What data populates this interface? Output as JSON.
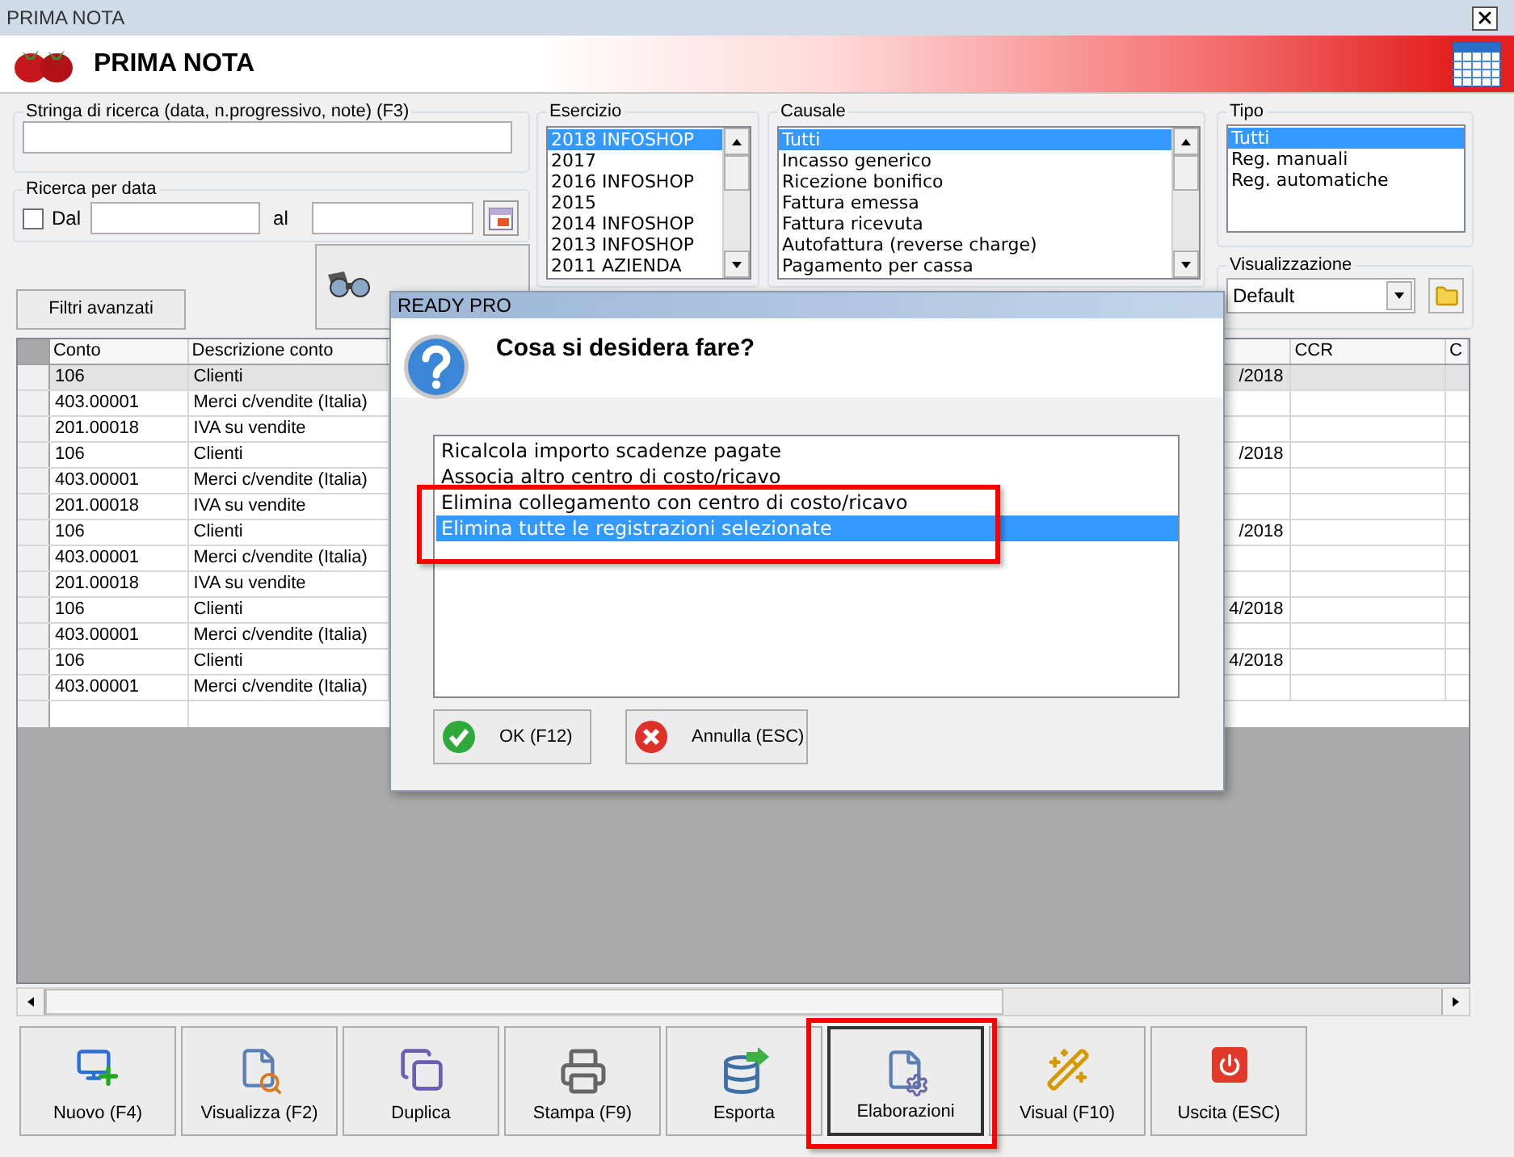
{
  "window": {
    "title": "PRIMA NOTA"
  },
  "header": {
    "title": "PRIMA NOTA"
  },
  "search": {
    "label": "Stringa di ricerca (data, n.progressivo, note) (F3)"
  },
  "date_filter": {
    "label": "Ricerca per data",
    "from_label": "Dal",
    "from_checked": false,
    "to_label": "al"
  },
  "advanced_filters_button": "Filtri avanzati",
  "esercizio": {
    "label": "Esercizio",
    "items": [
      {
        "label": "2018 INFOSHOP",
        "selected": true
      },
      {
        "label": "2017",
        "selected": false
      },
      {
        "label": "2016 INFOSHOP",
        "selected": false
      },
      {
        "label": "2015",
        "selected": false
      },
      {
        "label": "2014 INFOSHOP",
        "selected": false
      },
      {
        "label": "2013 INFOSHOP",
        "selected": false
      },
      {
        "label": "2011 AZIENDA",
        "selected": false
      }
    ]
  },
  "causale": {
    "label": "Causale",
    "items": [
      {
        "label": "Tutti",
        "selected": true
      },
      {
        "label": "Incasso generico",
        "selected": false
      },
      {
        "label": "Ricezione bonifico",
        "selected": false
      },
      {
        "label": "Fattura emessa",
        "selected": false
      },
      {
        "label": "Fattura ricevuta",
        "selected": false
      },
      {
        "label": "Autofattura (reverse charge)",
        "selected": false
      },
      {
        "label": "Pagamento per cassa",
        "selected": false
      }
    ]
  },
  "tipo": {
    "label": "Tipo",
    "items": [
      {
        "label": "Tutti",
        "selected": true
      },
      {
        "label": "Reg. manuali",
        "selected": false
      },
      {
        "label": "Reg. automatiche",
        "selected": false
      }
    ]
  },
  "visualizzazione": {
    "label": "Visualizzazione",
    "value": "Default"
  },
  "table": {
    "columns": [
      "Conto",
      "Descrizione conto",
      "CCR",
      "C"
    ],
    "rows": [
      {
        "conto": "106",
        "descrizione": "Clienti",
        "column_4": "/2018",
        "selected": true
      },
      {
        "conto": "403.00001",
        "descrizione": "Merci c/vendite (Italia)",
        "selected": false
      },
      {
        "conto": "201.00018",
        "descrizione": "IVA su vendite",
        "selected": false
      },
      {
        "conto": "106",
        "descrizione": "Clienti",
        "column_4": "/2018",
        "selected": false
      },
      {
        "conto": "403.00001",
        "descrizione": "Merci c/vendite (Italia)",
        "selected": false
      },
      {
        "conto": "201.00018",
        "descrizione": "IVA su vendite",
        "selected": false
      },
      {
        "conto": "106",
        "descrizione": "Clienti",
        "column_4": "/2018",
        "selected": false
      },
      {
        "conto": "403.00001",
        "descrizione": "Merci c/vendite (Italia)",
        "selected": false
      },
      {
        "conto": "201.00018",
        "descrizione": "IVA su vendite",
        "selected": false
      },
      {
        "conto": "106",
        "descrizione": "Clienti",
        "column_4": "4/2018",
        "selected": false
      },
      {
        "conto": "403.00001",
        "descrizione": "Merci c/vendite (Italia)",
        "selected": false
      },
      {
        "conto": "106",
        "descrizione": "Clienti",
        "column_4": "4/2018",
        "selected": false
      },
      {
        "conto": "403.00001",
        "descrizione": "Merci c/vendite (Italia)",
        "selected": false
      }
    ]
  },
  "toolbar": [
    {
      "label": "Nuovo (F4)",
      "focused": false
    },
    {
      "label": "Visualizza (F2)",
      "focused": false
    },
    {
      "label": "Duplica",
      "focused": false
    },
    {
      "label": "Stampa (F9)",
      "focused": false
    },
    {
      "label": "Esporta",
      "focused": false
    },
    {
      "label": "Elaborazioni",
      "focused": true
    },
    {
      "label": "Visual (F10)",
      "focused": false
    },
    {
      "label": "Uscita (ESC)",
      "focused": false
    }
  ],
  "dialog": {
    "title": "READY PRO",
    "question": "Cosa si desidera fare?",
    "options": [
      {
        "label": "Ricalcola importo scadenze pagate",
        "selected": false
      },
      {
        "label": "Associa altro centro di costo/ricavo",
        "selected": false
      },
      {
        "label": "Elimina collegamento con centro di costo/ricavo",
        "selected": false
      },
      {
        "label": "Elimina tutte le registrazioni selezionate",
        "selected": true
      }
    ],
    "buttons": [
      "OK (F12)",
      "Annulla (ESC)"
    ]
  }
}
